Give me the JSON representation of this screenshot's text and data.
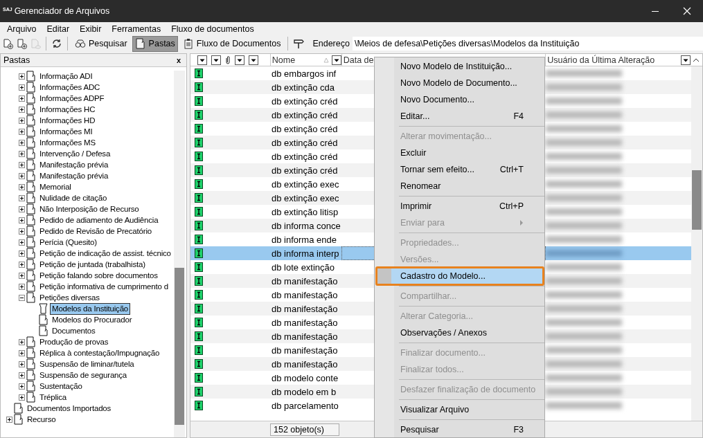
{
  "window": {
    "logo": "SAJ",
    "title": "Gerenciador de Arquivos"
  },
  "menu_bar": [
    "Arquivo",
    "Editar",
    "Exibir",
    "Ferramentas",
    "Fluxo de documentos"
  ],
  "toolbar": [
    {
      "kind": "icon",
      "disabled": false
    },
    {
      "kind": "icon",
      "disabled": false
    },
    {
      "kind": "icon",
      "disabled": true
    },
    {
      "kind": "separator"
    },
    {
      "kind": "icon",
      "disabled": false
    },
    {
      "kind": "separator"
    },
    {
      "kind": "button",
      "label": "Pesquisar",
      "selected": false
    },
    {
      "kind": "button",
      "label": "Pastas",
      "selected": true
    },
    {
      "kind": "button",
      "label": "Fluxo de Documentos",
      "selected": false
    },
    {
      "kind": "separator"
    },
    {
      "kind": "icon",
      "disabled": false
    }
  ],
  "address": {
    "label": "Endereço",
    "value": "\\Meios de defesa\\Petições diversas\\Modelos da Instituição"
  },
  "folders_pane": {
    "title": "Pastas",
    "close": "x",
    "tree": [
      {
        "children": [
          {
            "label": "Informação ADI",
            "expanded": false,
            "selected": false
          },
          {
            "label": "Informações ADC",
            "expanded": false,
            "selected": false
          },
          {
            "label": "Informações ADPF",
            "expanded": false,
            "selected": false
          },
          {
            "label": "Informações HC",
            "expanded": false,
            "selected": false
          },
          {
            "label": "Informações HD",
            "expanded": false,
            "selected": false
          },
          {
            "label": "Informações MI",
            "expanded": false,
            "selected": false
          },
          {
            "label": "Informações MS",
            "expanded": false,
            "selected": false
          },
          {
            "label": "Intervenção / Defesa",
            "expanded": false,
            "selected": false
          },
          {
            "label": "Manifestação prévia",
            "expanded": false,
            "selected": false
          },
          {
            "label": "Manifestação prévia",
            "expanded": false,
            "selected": false
          },
          {
            "label": "Memorial",
            "expanded": false,
            "selected": false
          },
          {
            "label": "Nulidade de citação",
            "expanded": false,
            "selected": false
          },
          {
            "label": "Não Interposição de Recurso",
            "expanded": false,
            "selected": false
          },
          {
            "label": "Pedido de adiamento de Audiência",
            "expanded": false,
            "selected": false
          },
          {
            "label": "Pedido de Revisão de Precatório",
            "expanded": false,
            "selected": false
          },
          {
            "label": "Perícia (Quesito)",
            "expanded": false,
            "selected": false
          },
          {
            "label": "Petição de indicação de assist. técnico",
            "expanded": false,
            "selected": false
          },
          {
            "label": "Petição de juntada (trabalhista)",
            "expanded": false,
            "selected": false
          },
          {
            "label": "Petição falando sobre documentos",
            "expanded": false,
            "selected": false
          },
          {
            "label": "Petição informativa de cumprimento d",
            "expanded": false,
            "selected": false
          },
          {
            "label": "Petições diversas",
            "expanded": true,
            "selected": false,
            "children": [
              {
                "label": "Modelos da Instituição",
                "selected": true
              },
              {
                "label": "Modelos do Procurador",
                "selected": false
              },
              {
                "label": "Documentos",
                "selected": false
              }
            ]
          },
          {
            "label": "Produção de provas",
            "expanded": false,
            "selected": false
          },
          {
            "label": "Réplica à contestação/Impugnação",
            "expanded": false,
            "selected": false
          },
          {
            "label": "Suspensão de liminar/tutela",
            "expanded": false,
            "selected": false
          },
          {
            "label": "Suspensão de segurança",
            "expanded": false,
            "selected": false
          },
          {
            "label": "Sustentação",
            "expanded": false,
            "selected": false
          },
          {
            "label": "Tréplica",
            "expanded": false,
            "selected": false
          }
        ]
      },
      {
        "label": "Documentos Importados",
        "selected": false
      },
      {
        "label": "Recurso",
        "expanded": false,
        "selected": false
      }
    ]
  },
  "file_list": {
    "columns": [
      "Nome",
      "Data de",
      "Usuário da Última Alteração"
    ],
    "rows": [
      {
        "name": "db embargos inf",
        "selected": false
      },
      {
        "name": "db extinção cda",
        "selected": false
      },
      {
        "name": "db extinção créd",
        "selected": false
      },
      {
        "name": "db extinção créd",
        "selected": false
      },
      {
        "name": "db extinção créd",
        "selected": false
      },
      {
        "name": "db extinção créd",
        "selected": false
      },
      {
        "name": "db extinção créd",
        "selected": false
      },
      {
        "name": "db extinção créd",
        "selected": false
      },
      {
        "name": "db extinção exec",
        "selected": false
      },
      {
        "name": "db extinção exec",
        "selected": false
      },
      {
        "name": "db extinção litisp",
        "selected": false
      },
      {
        "name": "db informa conce",
        "selected": false
      },
      {
        "name": "db informa ende",
        "selected": false
      },
      {
        "name": "db informa interp",
        "selected": true
      },
      {
        "name": "db lote extinção",
        "selected": false
      },
      {
        "name": "db manifestação",
        "selected": false
      },
      {
        "name": "db manifestação",
        "selected": false
      },
      {
        "name": "db manifestação",
        "selected": false
      },
      {
        "name": "db manifestação",
        "selected": false
      },
      {
        "name": "db manifestação",
        "selected": false
      },
      {
        "name": "db manifestação",
        "selected": false
      },
      {
        "name": "db manifestação",
        "selected": false
      },
      {
        "name": "db modelo conte",
        "selected": false
      },
      {
        "name": "db modelo em b",
        "selected": false
      },
      {
        "name": "db parcelamento",
        "selected": false
      }
    ],
    "status": "152 objeto(s)"
  },
  "context_menu": [
    {
      "kind": "item",
      "label": "Novo Modelo de Instituição...",
      "disabled": false,
      "selected": false
    },
    {
      "kind": "item",
      "label": "Novo Modelo de Documento...",
      "disabled": false,
      "selected": false
    },
    {
      "kind": "item",
      "label": "Novo Documento...",
      "disabled": false,
      "selected": false
    },
    {
      "kind": "item",
      "label": "Editar...",
      "shortcut": "F4",
      "disabled": false,
      "selected": false
    },
    {
      "kind": "separator"
    },
    {
      "kind": "item",
      "label": "Alterar movimentação...",
      "disabled": true,
      "selected": false
    },
    {
      "kind": "item",
      "label": "Excluir",
      "disabled": false,
      "selected": false
    },
    {
      "kind": "item",
      "label": "Tornar sem efeito...",
      "shortcut": "Ctrl+T",
      "disabled": false,
      "selected": false
    },
    {
      "kind": "item",
      "label": "Renomear",
      "disabled": false,
      "selected": false
    },
    {
      "kind": "separator"
    },
    {
      "kind": "item",
      "label": "Imprimir",
      "shortcut": "Ctrl+P",
      "disabled": false,
      "selected": false
    },
    {
      "kind": "submenu",
      "label": "Enviar para",
      "disabled": true,
      "selected": false
    },
    {
      "kind": "separator"
    },
    {
      "kind": "item",
      "label": "Propriedades...",
      "disabled": true,
      "selected": false
    },
    {
      "kind": "item",
      "label": "Versões...",
      "disabled": true,
      "selected": false
    },
    {
      "kind": "item",
      "label": "Cadastro do Modelo...",
      "disabled": false,
      "selected": true,
      "highlighted": true
    },
    {
      "kind": "separator"
    },
    {
      "kind": "item",
      "label": "Compartilhar...",
      "disabled": true,
      "selected": false
    },
    {
      "kind": "separator"
    },
    {
      "kind": "item",
      "label": "Alterar Categoria...",
      "disabled": true,
      "selected": false
    },
    {
      "kind": "item",
      "label": "Observações / Anexos",
      "disabled": false,
      "selected": false
    },
    {
      "kind": "separator"
    },
    {
      "kind": "item",
      "label": "Finalizar documento...",
      "disabled": true,
      "selected": false
    },
    {
      "kind": "item",
      "label": "Finalizar todos...",
      "disabled": true,
      "selected": false
    },
    {
      "kind": "separator"
    },
    {
      "kind": "item",
      "label": "Desfazer finalização de documento",
      "disabled": true,
      "selected": false
    },
    {
      "kind": "separator"
    },
    {
      "kind": "item",
      "label": "Visualizar Arquivo",
      "disabled": false,
      "selected": false
    },
    {
      "kind": "separator"
    },
    {
      "kind": "item",
      "label": "Pesquisar",
      "shortcut": "F3",
      "disabled": false,
      "selected": false
    }
  ]
}
